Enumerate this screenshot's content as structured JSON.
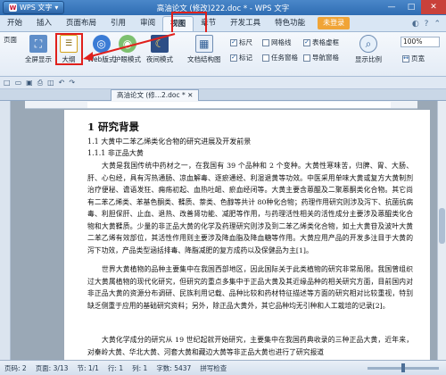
{
  "title_bar": {
    "app_name": "WPS 文字",
    "document_title": "高油论文 (修改)222.doc * - WPS 文字",
    "minimize": "—",
    "maximize": "□",
    "close": "✕"
  },
  "menu_tabs": [
    "开始",
    "插入",
    "页面布局",
    "引用",
    "审阅",
    "视图",
    "章节",
    "开发工具",
    "特色功能"
  ],
  "active_tab": "视图",
  "login_button": "未登录",
  "ribbon": {
    "page_view": "页面",
    "full_screen": "全屏显示",
    "outline": "大纲",
    "web_layout": "Web版式",
    "eye_mode": "护眼模式",
    "night_mode": "夜间模式",
    "doc_structure": "文档结构图",
    "checkboxes": [
      {
        "label": "标尺",
        "checked": true
      },
      {
        "label": "网格线",
        "checked": false
      },
      {
        "label": "表格虚框",
        "checked": true
      },
      {
        "label": "标记",
        "checked": true
      },
      {
        "label": "任务窗格",
        "checked": false
      },
      {
        "label": "导航窗格",
        "checked": false
      }
    ],
    "display_ratio": "显示比例",
    "zoom_value": "100%",
    "page_width": "页宽"
  },
  "doc_tab": "高油论文 (修...2.doc *",
  "document": {
    "heading1": "1 研究背景",
    "heading2": "1.1 大黄中二苯乙烯类化合物的研究进展及开发前景",
    "heading3": "1.1.1 非正品大黄",
    "para1": "大黄是我国传统中药材之一，在我国有 39 个品种和 2 个变种。大黄性寒味苦，归脾、胃、大肠、肝、心包经，具有泻热通肠、凉血解毒、逐瘀通经、利湿退黄等功效。中医采用单味大黄或复方大黄制剂治疗便秘、谵语发狂、痈疡初起、血热吐衄、瘀血经闭等。大黄主要含蒽醌及二聚蒽酮类化合物。其它尚有二苯乙烯类、苯基色酮类、鞣质、萘类、色醇等共计 80种化合物；药理作用研究则涉及泻下、抗菌抗病毒、利胆保肝、止血、退热、改善肾功能、减肥等作用，与药理活性相关的活性成分主要涉及蒽醌类化合物和大黄鞣质。少量的非正品大黄的化学及药理研究则涉及到二苯乙烯类化合物，如土大黄苷及波叶大黄二苯乙烯有效部位，其活性作用则主要涉及降血脂及降血糖等作用。大黄应用产品的开发多注目于大黄的泻下功效，产品类型涵括排毒、降脂减肥的复方成药以及保健品为主[1]。",
    "para2": "世界大黄植物的品种主要集中在我国西部地区，因此国际关于此类植物的研究非常局限。我国曾组织过大黄属植物的现代化研究，但研究的重点多集中于正品大黄及其近缘品种的相关研究方面，目前国内对非正品大黄的资源分布调研、民族利用记载、品种比较和药材特征描述等方面的研究相对比较重视，特别缺乏侧重于应用的基础研究资料；另外，除正品大黄外，其它品种均无引种和人工栽培的记录[2]。",
    "para3": "大黄化学成分的研究从 19 世纪起就开始研究，主要集中在我国药典收录的三种正品大黄，近年来，对秦岭大黄、华北大黄、河套大黄和藏边大黄等非正品大黄也进行了研究报道"
  },
  "status_bar": {
    "page": "页码: 2",
    "pages": "页面: 3/13",
    "section": "节: 1/1",
    "line": "行: 1",
    "column": "列: 1",
    "word_count": "字数: 5437",
    "spell_check": "拼写检查"
  },
  "colors": {
    "highlight_red": "#e0201c",
    "title_bar_blue": "#2f6db3",
    "login_orange": "#f0a437"
  }
}
